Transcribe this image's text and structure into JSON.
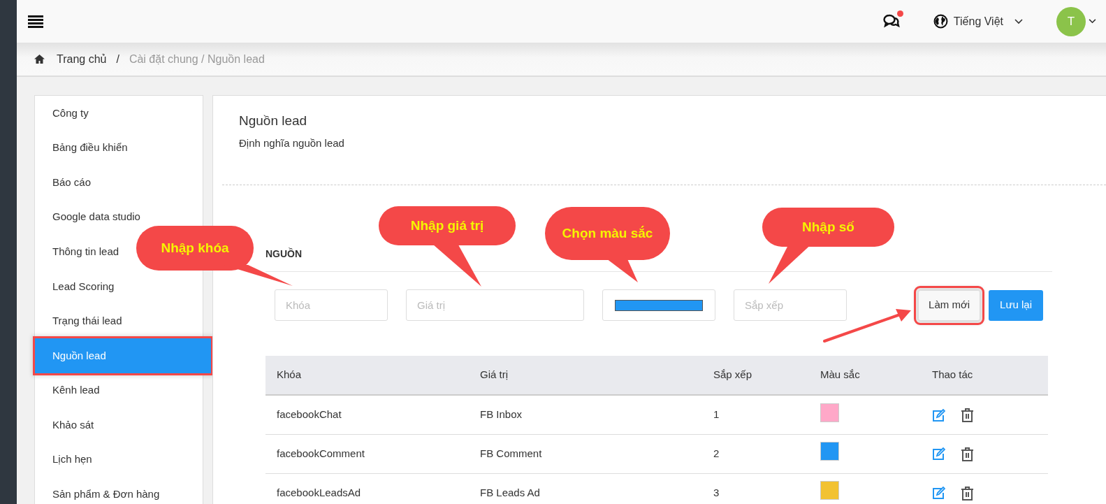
{
  "topbar": {
    "chat": {
      "unread": true
    },
    "language": "Tiếng Việt",
    "avatar": "T"
  },
  "breadcrumb": {
    "home": "Trang chủ",
    "separator": "/",
    "current": "Cài đặt chung / Nguồn lead"
  },
  "sidebar": {
    "items": [
      {
        "label": "Công ty",
        "selected": false,
        "highlighted": false
      },
      {
        "label": "Bảng điều khiển",
        "selected": false,
        "highlighted": false
      },
      {
        "label": "Báo cáo",
        "selected": false,
        "highlighted": false
      },
      {
        "label": "Google data studio",
        "selected": false,
        "highlighted": false
      },
      {
        "label": "Thông tin lead",
        "selected": false,
        "highlighted": false
      },
      {
        "label": "Lead Scoring",
        "selected": false,
        "highlighted": false
      },
      {
        "label": "Trạng thái lead",
        "selected": false,
        "highlighted": false
      },
      {
        "label": "Nguồn lead",
        "selected": true,
        "highlighted": true
      },
      {
        "label": "Kênh lead",
        "selected": false,
        "highlighted": false
      },
      {
        "label": "Khảo sát",
        "selected": false,
        "highlighted": false
      },
      {
        "label": "Lịch hẹn",
        "selected": false,
        "highlighted": false
      },
      {
        "label": "Sản phẩm & Đơn hàng",
        "selected": false,
        "highlighted": false
      }
    ]
  },
  "content": {
    "title": "Nguồn lead",
    "subtitle": "Định nghĩa nguồn lead",
    "section": "NGUỒN",
    "fields": [
      {
        "kind": "text",
        "placeholder": "Khóa"
      },
      {
        "kind": "text",
        "placeholder": "Giá trị"
      },
      {
        "kind": "color",
        "color": "#2196f3"
      },
      {
        "kind": "text",
        "placeholder": "Sắp xếp"
      }
    ],
    "buttons": [
      {
        "label": "Làm mới",
        "kind": "secondary",
        "highlighted": true
      },
      {
        "label": "Lưu lại",
        "kind": "primary",
        "highlighted": false
      }
    ],
    "table": {
      "columns": [
        "Khóa",
        "Giá trị",
        "Sắp xếp",
        "Màu sắc",
        "Thao tác"
      ],
      "rows": [
        {
          "key": "facebookChat",
          "value": "FB Inbox",
          "order": "1",
          "color": "#ffa8c8"
        },
        {
          "key": "facebookComment",
          "value": "FB Comment",
          "order": "2",
          "color": "#2196f3"
        },
        {
          "key": "facebookLeadsAd",
          "value": "FB Leads Ad",
          "order": "3",
          "color": "#f2c232"
        }
      ]
    }
  },
  "annotations": [
    {
      "text": "Nhập khóa"
    },
    {
      "text": "Nhập giá trị"
    },
    {
      "text": "Chọn màu sắc"
    },
    {
      "text": "Nhập số"
    }
  ]
}
